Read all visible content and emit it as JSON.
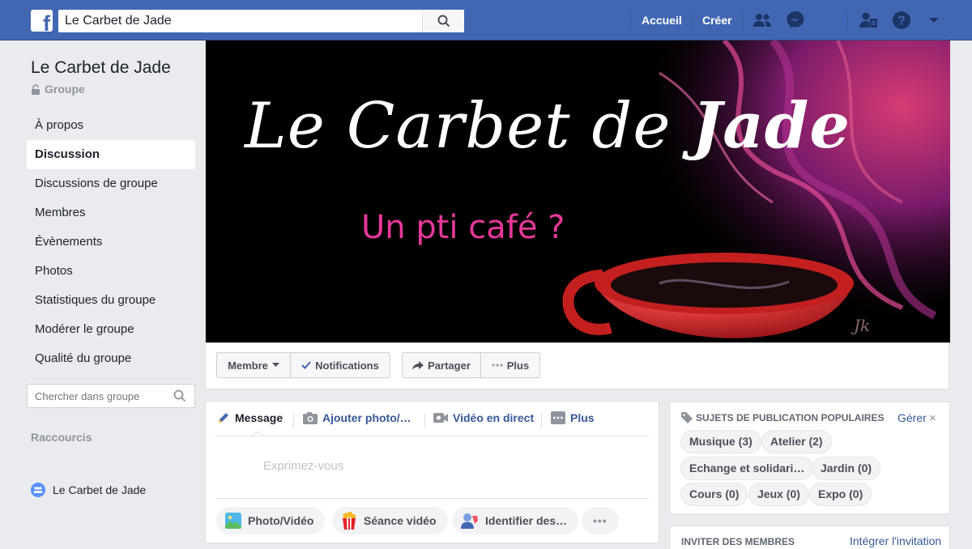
{
  "topbar": {
    "search_value": "Le Carbet de Jade",
    "nav": [
      "Accueil",
      "Créer"
    ],
    "icons": [
      "friends-icon",
      "messenger-icon",
      "friend-requests-icon",
      "help-icon",
      "dropdown-icon"
    ]
  },
  "group": {
    "title": "Le Carbet de Jade",
    "type": "Groupe"
  },
  "sidebar": {
    "items": [
      {
        "label": "À propos"
      },
      {
        "label": "Discussion"
      },
      {
        "label": "Discussions de groupe"
      },
      {
        "label": "Membres"
      },
      {
        "label": "Évènements"
      },
      {
        "label": "Photos"
      },
      {
        "label": "Statistiques du groupe"
      },
      {
        "label": "Modérer le groupe"
      },
      {
        "label": "Qualité du groupe"
      }
    ],
    "active": "Discussion",
    "search_placeholder": "Chercher dans groupe",
    "shortcuts_title": "Raccourcis",
    "shortcut": "Le Carbet de Jade"
  },
  "cover": {
    "title_light": "Le Carbet de",
    "title_bold": "Jade",
    "subtitle": "Un pti café ?",
    "signature": "Jk"
  },
  "actions": {
    "member": "Membre",
    "notifications": "Notifications",
    "share": "Partager",
    "more": "Plus"
  },
  "composer": {
    "tabs": [
      "Message",
      "Ajouter photo/…",
      "Vidéo en direct",
      "Plus"
    ],
    "placeholder": "Exprimez-vous",
    "pills": [
      "Photo/Vidéo",
      "Séance vidéo",
      "Identifier des…"
    ],
    "more_pill": "•••"
  },
  "topics": {
    "title": "SUJETS DE PUBLICATION POPULAIRES",
    "manage": "Gérer",
    "close": "×",
    "chips": [
      "Musique (3)",
      "Atelier (2)",
      "Echange et solidari…",
      "Jardin (0)",
      "Cours (0)",
      "Jeux (0)",
      "Expo (0)"
    ]
  },
  "invite": {
    "title": "INVITER DES MEMBRES",
    "link": "Intégrer l'invitation"
  },
  "colors": {
    "brand": "#4267b2",
    "link": "#365899",
    "cover_subtitle": "#e6389b",
    "cup": "#c41f1f"
  }
}
